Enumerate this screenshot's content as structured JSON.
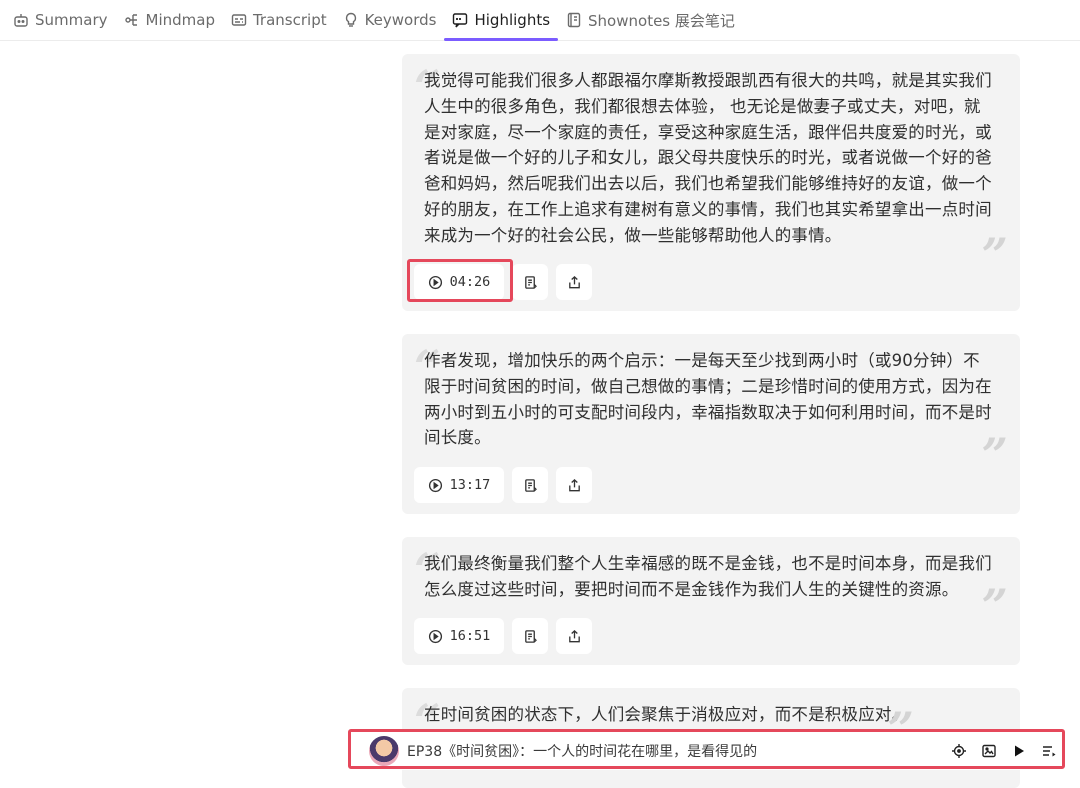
{
  "tabs": [
    {
      "label": "Summary",
      "icon": "robot-icon",
      "active": false
    },
    {
      "label": "Mindmap",
      "icon": "mindmap-icon",
      "active": false
    },
    {
      "label": "Transcript",
      "icon": "transcript-icon",
      "active": false
    },
    {
      "label": "Keywords",
      "icon": "lightbulb-icon",
      "active": false
    },
    {
      "label": "Highlights",
      "icon": "quote-bubble-icon",
      "active": true
    },
    {
      "label": "Shownotes 展会笔记",
      "icon": "notebook-icon",
      "active": false
    }
  ],
  "highlights": [
    {
      "quote": "我觉得可能我们很多人都跟福尔摩斯教授跟凯西有很大的共鸣，就是其实我们人生中的很多角色，我们都很想去体验， 也无论是做妻子或丈夫，对吧，就是对家庭，尽一个家庭的责任，享受这种家庭生活，跟伴侣共度爱的时光，或者说是做一个好的儿子和女儿，跟父母共度快乐的时光，或者说做一个好的爸爸和妈妈，然后呢我们出去以后，我们也希望我们能够维持好的友谊，做一个好的朋友，在工作上追求有建树有意义的事情，我们也其实希望拿出一点时间来成为一个好的社会公民，做一些能够帮助他人的事情。",
      "time": "04:26"
    },
    {
      "quote": "作者发现，增加快乐的两个启示：一是每天至少找到两小时（或90分钟）不限于时间贫困的时间，做自己想做的事情；二是珍惜时间的使用方式，因为在两小时到五小时的可支配时间段内，幸福指数取决于如何利用时间，而不是时间长度。",
      "time": "13:17"
    },
    {
      "quote": "我们最终衡量我们整个人生幸福感的既不是金钱，也不是时间本身，而是我们怎么度过这些时间，要把时间而不是金钱作为我们人生的关键性的资源。",
      "time": "16:51"
    },
    {
      "quote": "在时间贫困的状态下，人们会聚焦于消极应对，而不是积极应对。",
      "time": ""
    }
  ],
  "player": {
    "title": "EP38《时间贫困》：一个人的时间花在哪里，是看得见的",
    "controls": [
      "locate-icon",
      "image-icon",
      "play-icon",
      "playlist-icon"
    ]
  },
  "colors": {
    "accent": "#7b5cff",
    "highlight_border": "#e5485b",
    "card_bg": "#f3f3f3"
  }
}
